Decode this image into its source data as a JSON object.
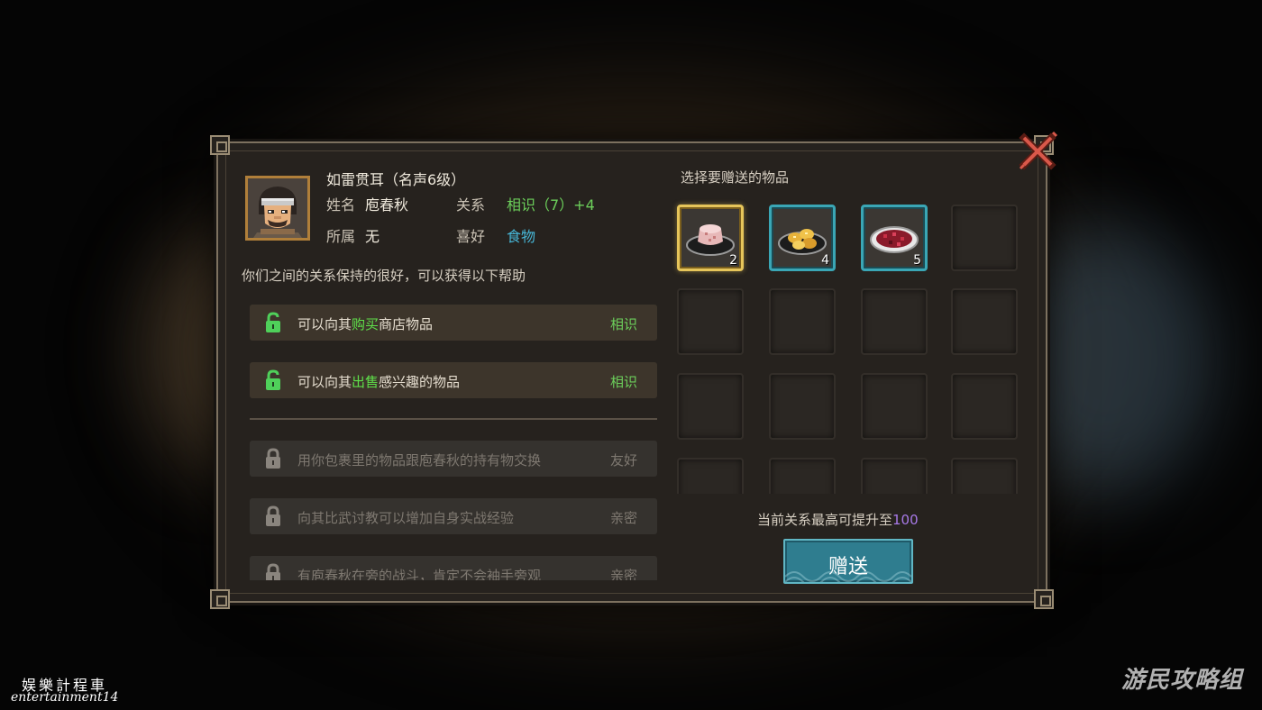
{
  "npc": {
    "title": "如雷贯耳（名声6级）",
    "name_label": "姓名",
    "name": "庖春秋",
    "relation_label": "关系",
    "relation": "相识（7）+4",
    "faction_label": "所属",
    "faction": "无",
    "preference_label": "喜好",
    "preference": "食物"
  },
  "relationship_desc": "你们之间的关系保持的很好，可以获得以下帮助",
  "benefits": [
    {
      "pre": "可以向其",
      "highlight": "购买",
      "post": "商店物品",
      "requirement": "相识",
      "unlocked": true
    },
    {
      "pre": "可以向其",
      "highlight": "出售",
      "post": "感兴趣的物品",
      "requirement": "相识",
      "unlocked": true
    },
    {
      "text": "用你包裹里的物品跟庖春秋的持有物交换",
      "requirement": "友好",
      "unlocked": false
    },
    {
      "text": "向其比武讨教可以增加自身实战经验",
      "requirement": "亲密",
      "unlocked": false
    },
    {
      "text": "有庖春秋在旁的战斗，肯定不会袖手旁观",
      "requirement": "亲密",
      "unlocked": false
    }
  ],
  "gift_panel": {
    "title": "选择要赠送的物品",
    "items": [
      {
        "icon": "rice-cake-icon",
        "quantity": "2",
        "selected": true
      },
      {
        "icon": "fried-dumplings-icon",
        "quantity": "4",
        "selected": false
      },
      {
        "icon": "berry-dish-icon",
        "quantity": "5",
        "selected": false
      }
    ],
    "limit_prefix": "当前关系最高可提升至",
    "limit_value": "100",
    "button_label": "赠送"
  },
  "watermarks": {
    "left_line1": "娱樂計程車",
    "left_line2": "entertainment14",
    "right": "游民攻略组"
  },
  "colors": {
    "relation_green": "#6ccf5b",
    "preference_blue": "#47b6d6",
    "limit_purple": "#a87ae8",
    "selected_gold": "#e6c55a",
    "slot_teal": "#3aa6b5"
  }
}
